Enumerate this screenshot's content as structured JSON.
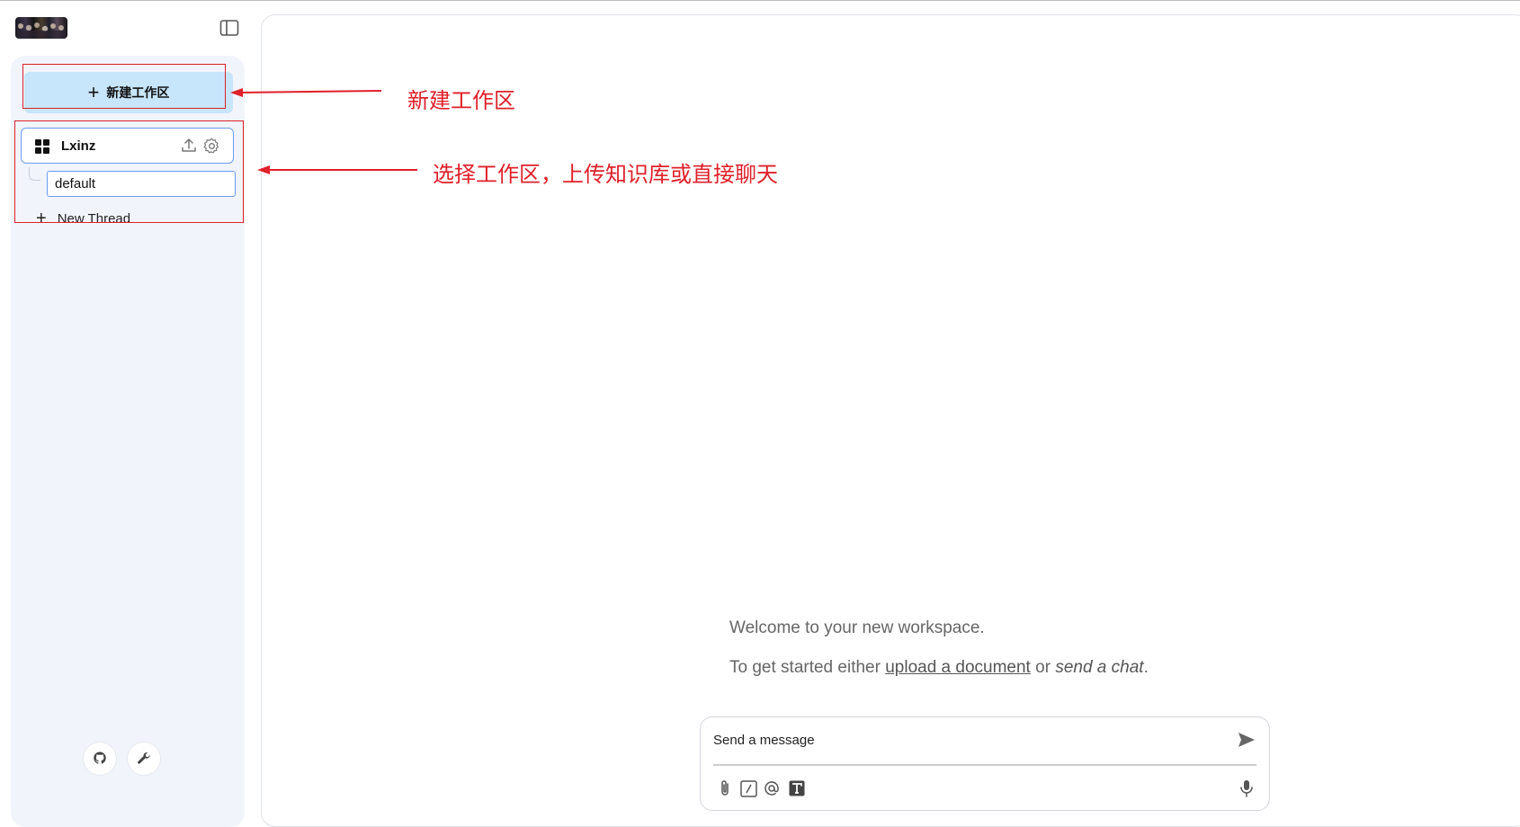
{
  "sidebar": {
    "new_workspace_label": "新建工作区",
    "workspace": {
      "name": "Lxinz"
    },
    "thread": {
      "name": "default"
    },
    "new_thread_label": "New Thread"
  },
  "annotations": [
    {
      "text": "新建工作区"
    },
    {
      "text": "选择工作区，上传知识库或直接聊天"
    }
  ],
  "main": {
    "welcome": "Welcome to your new workspace.",
    "started_prefix": "To get started either",
    "upload_link": "upload a document",
    "or": "or",
    "send_chat": "send a chat",
    "period": "."
  },
  "composer": {
    "placeholder": "Send a message"
  },
  "colors": {
    "accent_blue": "#c7e5fb",
    "annotation_red": "#e0202a",
    "selection_border": "#6a9cf2"
  }
}
